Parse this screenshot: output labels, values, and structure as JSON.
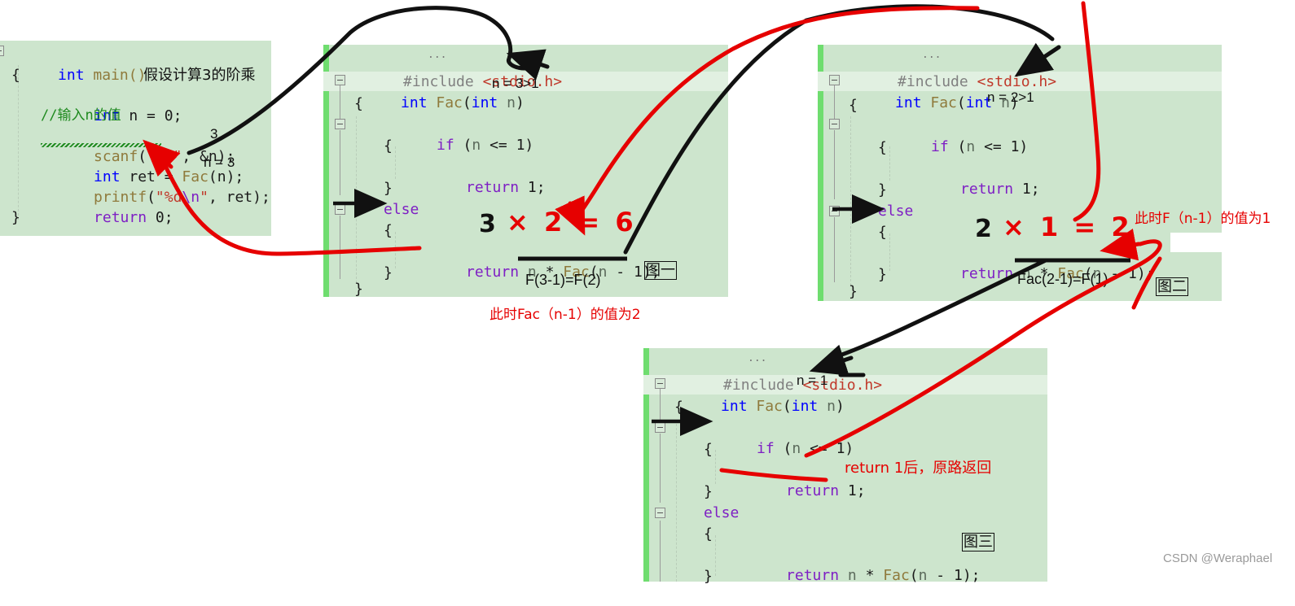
{
  "page": {
    "watermark": "CSDN @Weraphael",
    "title_note": "假设计算3的阶乘"
  },
  "blocks": [
    {
      "id": "main-block",
      "caption": "",
      "lines": [
        "int main()",
        "{",
        "    int n = 0;",
        "    //输入n的值",
        "    scanf(\"%d\", &n);",
        "    int ret = Fac(n);",
        "    printf(\"%d\\n\", ret);",
        "    return 0;",
        "}"
      ]
    },
    {
      "id": "fig-one-block",
      "caption": "图一",
      "lines": [
        "...",
        "#include <stdio.h>",
        "int Fac(int n)",
        "{",
        "    if (n <= 1)",
        "    {",
        "        return 1;",
        "    }",
        "    else",
        "    {",
        "        return n * Fac(n - 1);",
        "    }",
        "}"
      ]
    },
    {
      "id": "fig-two-block",
      "caption": "图二",
      "lines": [
        "...",
        "#include <stdio.h>",
        "int Fac(int n)",
        "{",
        "    if (n <= 1)",
        "    {",
        "        return 1;",
        "    }",
        "    else",
        "    {",
        "        return n * Fac(n - 1);",
        "    }",
        "}"
      ]
    },
    {
      "id": "fig-three-block",
      "caption": "图三",
      "lines": [
        "...",
        "#include <stdio.h>",
        "int Fac(int n)",
        "{",
        "    if (n <= 1)",
        "    {",
        "        return 1;",
        "    }",
        "    else",
        "    {",
        "        return n * Fac(n - 1);",
        "    }"
      ]
    }
  ],
  "code_tokens": {
    "block1": {
      "l1_kw": "int",
      "l1_fn": " main()",
      "l2": "{",
      "l3_kw": "int",
      "l3_rest": " n = 0;",
      "l4_comment": "//输入n的值",
      "l5_fn": "scanf",
      "l5_open": "(",
      "l5_str": "\"%d\"",
      "l5_mid": ", &n);",
      "l6_kw": "int",
      "l6_mid": " ret = ",
      "l6_fn": "Fac",
      "l6_rest": "(n);",
      "l7_fn": "printf",
      "l7_open": "(",
      "l7_str": "\"%d",
      "l7_esc": "\\n",
      "l7_str2": "\"",
      "l7_rest": ", ret);",
      "l8_kw": "return",
      "l8_rest": " 0;",
      "l9": "}"
    },
    "fac": {
      "dots": "...",
      "inc_kw": "#include",
      "inc_hdr": "<stdio.h>",
      "sig_kw": "int",
      "sig_fn": " Fac",
      "sig_open": "(",
      "sig_kw2": "int",
      "sig_arg": " n",
      "sig_close": ")",
      "brace_open": "{",
      "if_kw": "if",
      "if_cond_open": " (",
      "if_var": "n",
      "if_rest": " <= 1)",
      "inner_open": "{",
      "ret_kw": "return",
      "ret_one": " 1;",
      "inner_close": "}",
      "else_kw": "else",
      "else_open": "{",
      "ret2_kw": "return",
      "ret2_var": " n ",
      "ret2_star": "* ",
      "ret2_fn": "Fac",
      "ret2_args_open": "(",
      "ret2_n": "n",
      "ret2_args_rest": " - 1);",
      "else_close": "}",
      "brace_close": "}"
    }
  },
  "annotations": {
    "note_main": "假设计算3的阶乘",
    "scanf_value": "3",
    "main_n_value": "n = 3",
    "fig1_n": "n = 3>1",
    "fig1_mul_black": "3",
    "fig1_mul_red": "× 2 = 6",
    "fig1_sub_label": "F(3-1)=F(2)",
    "fig1_caption": "图一",
    "fig1_red_note": "此时Fac（n-1）的值为2",
    "fig2_n": "n = 2>1",
    "fig2_mul_black": "2",
    "fig2_mul_red": "× 1 = 2",
    "fig2_sub_label": "Fac(2-1)=F(1)",
    "fig2_caption": "图二",
    "fig2_red_note": "此时F（n-1）的值为1",
    "fig3_n": "n = 1",
    "fig3_red_note": "return 1后，原路返回",
    "fig3_caption": "图三"
  },
  "colors": {
    "code_bg": "#cde5cd",
    "gutter_green": "#6fdd6f",
    "annotation_red": "#e60000",
    "annotation_black": "#111111",
    "keyword_blue": "#0000ff",
    "keyword_purple": "#7e1fc4",
    "comment_green": "#1f8a1f",
    "string_red": "#c0392b"
  }
}
